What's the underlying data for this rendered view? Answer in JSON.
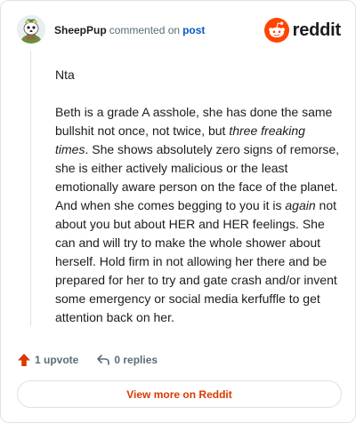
{
  "header": {
    "username": "SheepPup",
    "verb": "commented on",
    "post_link": "post",
    "brand_name": "reddit"
  },
  "comment": {
    "paragraph1": "Nta",
    "p2_part1": "Beth is a grade A asshole, she has done the same bullshit not once, not twice, but ",
    "p2_italic1": "three freaking times",
    "p2_part2": ". She shows absolutely zero signs of remorse, she is either actively malicious or the least emotionally aware person on the face of the planet. And when she comes begging to you it is ",
    "p2_italic2": "again",
    "p2_part3": " not about you but about HER and HER feelings. She can and will try to make the whole shower about herself. Hold firm in not allowing her there and be prepared for her to try and gate crash and/or invent some emergency or social media kerfuffle to get attention back on her."
  },
  "actions": {
    "upvote_label": "1 upvote",
    "replies_label": "0 replies"
  },
  "footer": {
    "view_more_label": "View more on Reddit"
  },
  "colors": {
    "brand_orange": "#ff4500",
    "upvote_orange": "#d93a00",
    "link_blue": "#0a58ca",
    "muted_text": "#576f76"
  },
  "icons": {
    "avatar": "snoo-avatar-icon",
    "brand": "reddit-logo-icon",
    "upvote": "upvote-arrow-icon",
    "reply": "reply-arrow-icon"
  }
}
